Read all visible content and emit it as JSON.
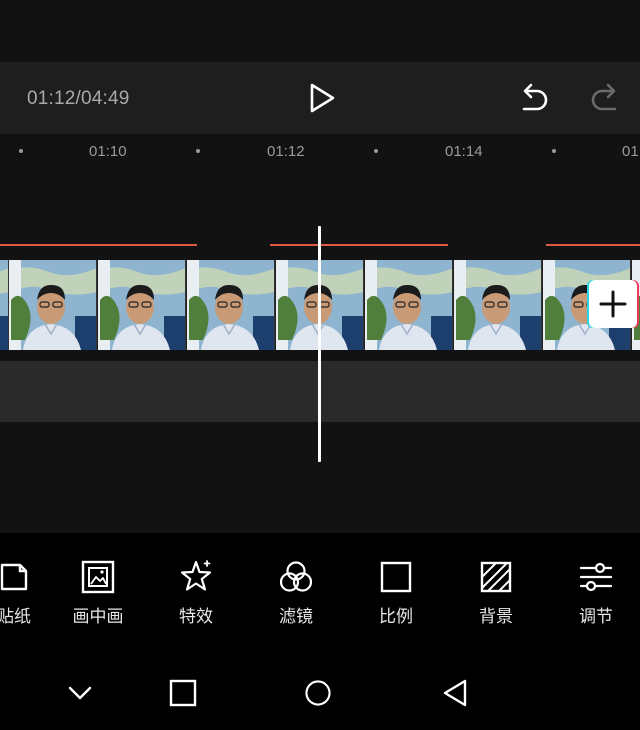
{
  "player": {
    "timecode": "01:12/04:49",
    "play_icon": "play-icon",
    "undo_icon": "undo-icon",
    "redo_icon": "redo-icon"
  },
  "ruler": {
    "labels": [
      "01:10",
      "01:12",
      "01:14",
      "01"
    ]
  },
  "colors": {
    "audio_line": "#e05a43",
    "playhead": "#ffffff",
    "accent_cyan": "#27d6e3",
    "accent_pink": "#f2385a"
  },
  "toolbar": {
    "items": [
      {
        "label": "贴纸",
        "icon": "sticker-icon"
      },
      {
        "label": "画中画",
        "icon": "picture-in-picture-icon"
      },
      {
        "label": "特效",
        "icon": "effects-star-icon"
      },
      {
        "label": "滤镜",
        "icon": "filter-icon"
      },
      {
        "label": "比例",
        "icon": "ratio-icon"
      },
      {
        "label": "背景",
        "icon": "background-icon"
      },
      {
        "label": "调节",
        "icon": "adjust-sliders-icon"
      }
    ]
  },
  "navbar": {
    "items": [
      "collapse-down-icon",
      "recents-square-icon",
      "home-circle-icon",
      "back-triangle-icon"
    ]
  }
}
